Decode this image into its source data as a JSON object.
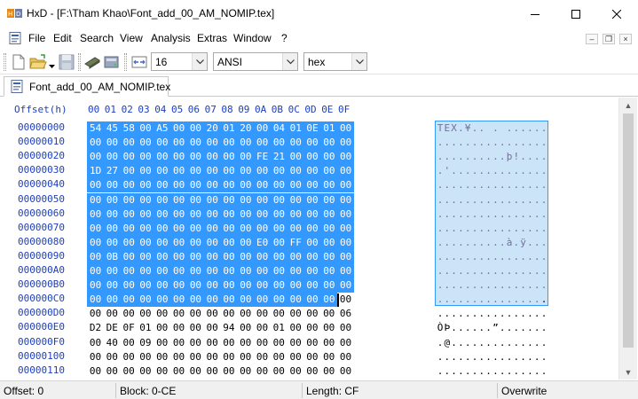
{
  "window": {
    "title": "HxD - [F:\\Tham Khao\\Font_add_00_AM_NOMIP.tex]"
  },
  "menu": [
    "File",
    "Edit",
    "Search",
    "View",
    "Analysis",
    "Extras",
    "Window",
    "?"
  ],
  "toolbar": {
    "bytes_per_row": "16",
    "charset": "ANSI",
    "offset_base": "hex",
    "icons": [
      "new-file-icon",
      "open-folder-icon",
      "save-icon",
      "ram-icon",
      "disk-icon",
      "columns-icon"
    ]
  },
  "tab": {
    "label": "Font_add_00_AM_NOMIP.tex"
  },
  "editor": {
    "header_offset_label": "Offset(h)",
    "columns": [
      "00",
      "01",
      "02",
      "03",
      "04",
      "05",
      "06",
      "07",
      "08",
      "09",
      "0A",
      "0B",
      "0C",
      "0D",
      "0E",
      "0F"
    ],
    "rows": [
      {
        "offset": "00000000",
        "bytes": [
          "54",
          "45",
          "58",
          "00",
          "A5",
          "00",
          "00",
          "20",
          "01",
          "20",
          "00",
          "04",
          "01",
          "0E",
          "01",
          "00"
        ],
        "text": "TEX.¥.. . ......"
      },
      {
        "offset": "00000010",
        "bytes": [
          "00",
          "00",
          "00",
          "00",
          "00",
          "00",
          "00",
          "00",
          "00",
          "00",
          "00",
          "00",
          "00",
          "00",
          "00",
          "00"
        ],
        "text": "................"
      },
      {
        "offset": "00000020",
        "bytes": [
          "00",
          "00",
          "00",
          "00",
          "00",
          "00",
          "00",
          "00",
          "00",
          "00",
          "FE",
          "21",
          "00",
          "00",
          "00",
          "00"
        ],
        "text": "..........þ!...."
      },
      {
        "offset": "00000030",
        "bytes": [
          "1D",
          "27",
          "00",
          "00",
          "00",
          "00",
          "00",
          "00",
          "00",
          "00",
          "00",
          "00",
          "00",
          "00",
          "00",
          "00"
        ],
        "text": ".'.............."
      },
      {
        "offset": "00000040",
        "bytes": [
          "00",
          "00",
          "00",
          "00",
          "00",
          "00",
          "00",
          "00",
          "00",
          "00",
          "00",
          "00",
          "00",
          "00",
          "00",
          "00"
        ],
        "text": "................"
      },
      {
        "offset": "00000050",
        "bytes": [
          "00",
          "00",
          "00",
          "00",
          "00",
          "00",
          "00",
          "00",
          "00",
          "00",
          "00",
          "00",
          "00",
          "00",
          "00",
          "00"
        ],
        "text": "................"
      },
      {
        "offset": "00000060",
        "bytes": [
          "00",
          "00",
          "00",
          "00",
          "00",
          "00",
          "00",
          "00",
          "00",
          "00",
          "00",
          "00",
          "00",
          "00",
          "00",
          "00"
        ],
        "text": "................"
      },
      {
        "offset": "00000070",
        "bytes": [
          "00",
          "00",
          "00",
          "00",
          "00",
          "00",
          "00",
          "00",
          "00",
          "00",
          "00",
          "00",
          "00",
          "00",
          "00",
          "00"
        ],
        "text": "................"
      },
      {
        "offset": "00000080",
        "bytes": [
          "00",
          "00",
          "00",
          "00",
          "00",
          "00",
          "00",
          "00",
          "00",
          "00",
          "E0",
          "00",
          "FF",
          "00",
          "00",
          "00"
        ],
        "text": "..........à.ÿ..."
      },
      {
        "offset": "00000090",
        "bytes": [
          "00",
          "0B",
          "00",
          "00",
          "00",
          "00",
          "00",
          "00",
          "00",
          "00",
          "00",
          "00",
          "00",
          "00",
          "00",
          "00"
        ],
        "text": "................"
      },
      {
        "offset": "000000A0",
        "bytes": [
          "00",
          "00",
          "00",
          "00",
          "00",
          "00",
          "00",
          "00",
          "00",
          "00",
          "00",
          "00",
          "00",
          "00",
          "00",
          "00"
        ],
        "text": "................"
      },
      {
        "offset": "000000B0",
        "bytes": [
          "00",
          "00",
          "00",
          "00",
          "00",
          "00",
          "00",
          "00",
          "00",
          "00",
          "00",
          "00",
          "00",
          "00",
          "00",
          "00"
        ],
        "text": "................"
      },
      {
        "offset": "000000C0",
        "bytes": [
          "00",
          "00",
          "00",
          "00",
          "00",
          "00",
          "00",
          "00",
          "00",
          "00",
          "00",
          "00",
          "00",
          "00",
          "00",
          "00"
        ],
        "text": "................"
      },
      {
        "offset": "000000D0",
        "bytes": [
          "00",
          "00",
          "00",
          "00",
          "00",
          "00",
          "00",
          "00",
          "00",
          "00",
          "00",
          "00",
          "00",
          "00",
          "00",
          "06"
        ],
        "text": "................"
      },
      {
        "offset": "000000E0",
        "bytes": [
          "D2",
          "DE",
          "0F",
          "01",
          "00",
          "00",
          "00",
          "00",
          "94",
          "00",
          "00",
          "01",
          "00",
          "00",
          "00",
          "00"
        ],
        "text": "ÒÞ......”......."
      },
      {
        "offset": "000000F0",
        "bytes": [
          "00",
          "40",
          "00",
          "09",
          "00",
          "00",
          "00",
          "00",
          "00",
          "00",
          "00",
          "00",
          "00",
          "00",
          "00",
          "00"
        ],
        "text": ".@.............."
      },
      {
        "offset": "00000100",
        "bytes": [
          "00",
          "00",
          "00",
          "00",
          "00",
          "00",
          "00",
          "00",
          "00",
          "00",
          "00",
          "00",
          "00",
          "00",
          "00",
          "00"
        ],
        "text": "................"
      },
      {
        "offset": "00000110",
        "bytes": [
          "00",
          "00",
          "00",
          "00",
          "00",
          "00",
          "00",
          "00",
          "00",
          "00",
          "00",
          "00",
          "00",
          "00",
          "00",
          "00"
        ],
        "text": "................"
      }
    ],
    "selection_end_byte": 206
  },
  "status": {
    "offset": "Offset: 0",
    "block": "Block: 0-CE",
    "length": "Length: CF",
    "mode": "Overwrite"
  },
  "colors": {
    "selection": "#3399ff",
    "offset_text": "#1d3fbf"
  }
}
